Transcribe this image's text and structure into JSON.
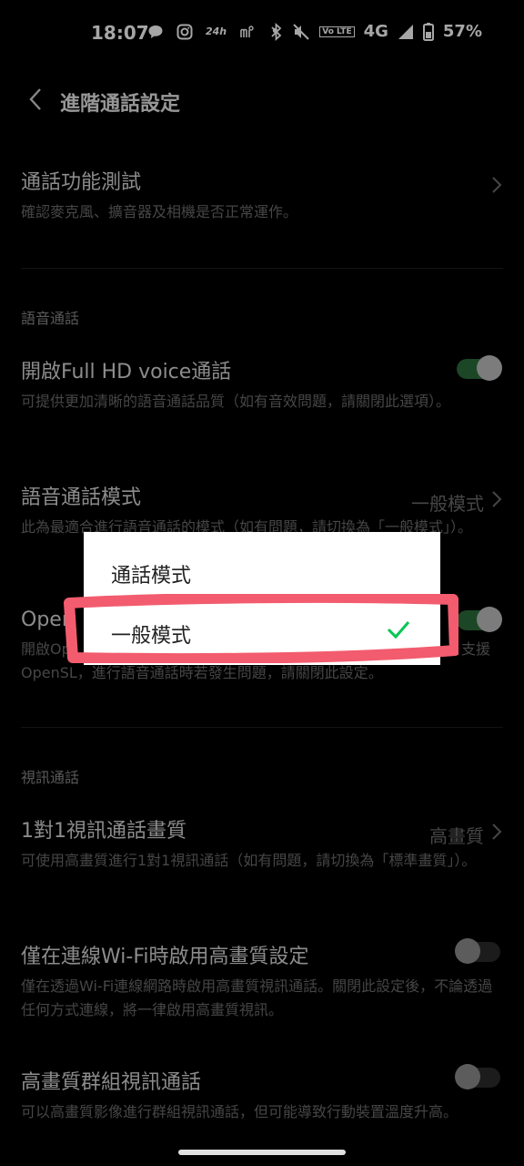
{
  "status_bar": {
    "time": "18:07",
    "badge_24h": "24h",
    "dot": "•",
    "volte": "Vo LTE",
    "network": "4G",
    "battery": "57%"
  },
  "header": {
    "title": "進階通話設定"
  },
  "items": {
    "call_test": {
      "title": "通話功能測試",
      "desc": "確認麥克風、擴音器及相機是否正常運作。"
    },
    "voice_section": "語音通話",
    "hd_voice": {
      "title": "開啟Full HD voice通話",
      "desc": "可提供更加清晰的語音通話品質（如有音效問題，請關閉此選項）。",
      "on": true
    },
    "voice_mode": {
      "title": "語音通話模式",
      "value": "一般模式",
      "desc": "此為最適合進行語音通話的模式（如有問題，請切換為「一般模式」）。"
    },
    "opensl": {
      "title": "Open",
      "desc_line1": "開啟Op",
      "desc_tail": "支援",
      "desc_line2": "OpenSL，進行語音通話時若發生問題，請關閉此設定。",
      "on": true
    },
    "video_section": "視訊通話",
    "video_quality": {
      "title": "1對1視訊通話畫質",
      "value": "高畫質",
      "desc": "可使用高畫質進行1對1視訊通話（如有問題，請切換為「標準畫質」）。"
    },
    "wifi_only": {
      "title": "僅在連線Wi-Fi時啟用高畫質設定",
      "desc": "僅在透過Wi-Fi連線網路時啟用高畫質視訊通話。關閉此設定後，不論透過任何方式連線，將一律啟用高畫質視訊。",
      "on": false
    },
    "group_hd": {
      "title": "高畫質群組視訊通話",
      "desc": "可以高畫質影像進行群組視訊通話，但可能導致行動裝置溫度升高。",
      "on": false
    }
  },
  "dialog": {
    "options": [
      {
        "label": "通話模式",
        "selected": false
      },
      {
        "label": "一般模式",
        "selected": true
      }
    ],
    "check_color": "#06c755",
    "highlight_color": "#f25c6e"
  }
}
